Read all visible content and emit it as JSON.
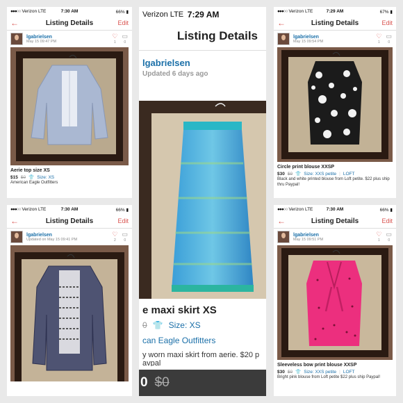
{
  "panels": {
    "p1": {
      "status": {
        "carrier": "Verizon",
        "network": "LTE",
        "time": "7:30 AM",
        "battery": "66%"
      },
      "nav": {
        "back": "←",
        "title": "Listing Details",
        "edit": "Edit"
      },
      "user": {
        "name": "lgabrielsen",
        "date": "May 15 09:47 PM",
        "likes": "1",
        "comments": "0"
      },
      "title": "Aerie top size XS",
      "price": "$15",
      "orig": "$0",
      "size": "Size: XS",
      "brand": "American Eagle Outfitters"
    },
    "p2": {
      "status": {
        "carrier": "Verizon",
        "network": "LTE",
        "time": "7:29 AM"
      },
      "nav": {
        "title": "Listing Details"
      },
      "user": {
        "name": "lgabrielsen",
        "date": "Updated 6 days ago"
      },
      "title": "e maxi skirt XS",
      "orig_partial": "0",
      "size": "Size: XS",
      "brand": "can Eagle Outfitters",
      "desc": "y worn maxi skirt from aerie. $20 p",
      "desc2": "avpal",
      "bottom_price": "0",
      "bottom_orig": "$0"
    },
    "p3": {
      "status": {
        "carrier": "Verizon",
        "network": "LTE",
        "time": "7:29 AM",
        "battery": "67%"
      },
      "nav": {
        "back": "←",
        "title": "Listing Details",
        "edit": "Edit"
      },
      "user": {
        "name": "lgabrielsen",
        "date": "May 15 09:54 PM",
        "likes": "1",
        "comments": "0"
      },
      "title": "Circle print blouse XXSP",
      "price": "$30",
      "orig": "$0",
      "size": "Size: XXS petite",
      "brand": "LOFT",
      "desc": "Black and white printed blouse from Loft petite. $22 plus ship thru Paypal!"
    },
    "p4": {
      "status": {
        "carrier": "Verizon",
        "network": "LTE",
        "time": "7:30 AM",
        "battery": "66%"
      },
      "nav": {
        "back": "←",
        "title": "Listing Details",
        "edit": "Edit"
      },
      "user": {
        "name": "lgabrielsen",
        "date": "Updated on May 15 09:41 PM",
        "likes": "2",
        "comments": "0"
      }
    },
    "p5": {
      "status": {
        "carrier": "Verizon",
        "network": "LTE",
        "time": "7:30 AM",
        "battery": "66%"
      },
      "nav": {
        "back": "←",
        "title": "Listing Details",
        "edit": "Edit"
      },
      "user": {
        "name": "lgabrielsen",
        "date": "May 15 09:51 PM",
        "likes": "1",
        "comments": "0"
      },
      "title": "Sleeveless bow print blouse XXSP",
      "price": "$30",
      "orig": "$0",
      "size": "Size: XXS petite",
      "brand": "LOFT",
      "desc": "Bright pink blouse from Loft petite $22 plus ship Paypal!"
    }
  },
  "colors": {
    "accent": "#d9534f",
    "link": "#1a6fa8"
  }
}
